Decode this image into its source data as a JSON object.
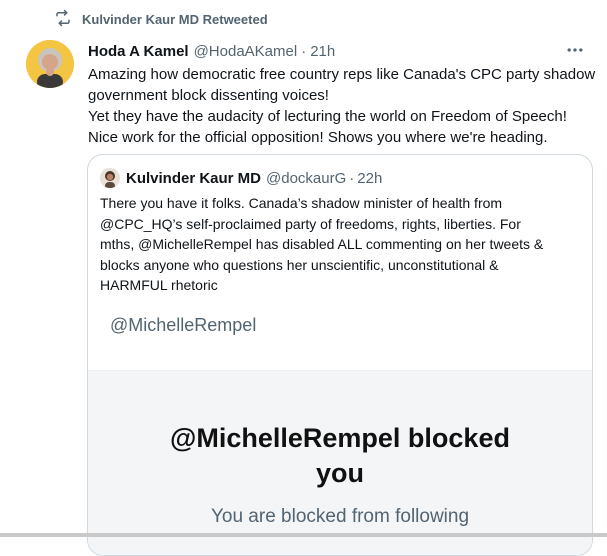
{
  "retweet": {
    "icon": "retweet-icon",
    "label": "Kulvinder Kaur MD Retweeted"
  },
  "tweet": {
    "avatar_icon": "avatar",
    "author_name": "Hoda A Kamel",
    "author_handle": "@HodaAKamel",
    "separator": "·",
    "time": "21h",
    "more_icon": "more-icon",
    "lines": [
      "Amazing how democratic free country reps like Canada's CPC party shadow",
      "government block dissenting voices!",
      "Yet they have the audacity of lecturing the world on Freedom of Speech!",
      "Nice work for the official opposition! Shows you where we're heading."
    ]
  },
  "quote": {
    "author_name": "Kulvinder Kaur MD",
    "author_handle": "@dockaurG",
    "separator": "·",
    "time": "22h",
    "lines": [
      "There you have it folks. Canada’s shadow minister of health from",
      "@CPC_HQ’s self-proclaimed party of freedoms, rights, liberties. For",
      "mths, @MichelleRempel has disabled ALL commenting on her tweets &",
      "blocks anyone who questions her unscientific, unconstitutional &",
      "HARMFUL rhetoric"
    ],
    "image": {
      "mention": "@MichelleRempel",
      "blocked_title_line1": "@MichelleRempel blocked",
      "blocked_title_line2": "you",
      "blocked_subtitle": "You are blocked from following"
    }
  },
  "colors": {
    "secondary_text": "#536471",
    "border": "#cfd9de",
    "text": "#0f1419"
  }
}
